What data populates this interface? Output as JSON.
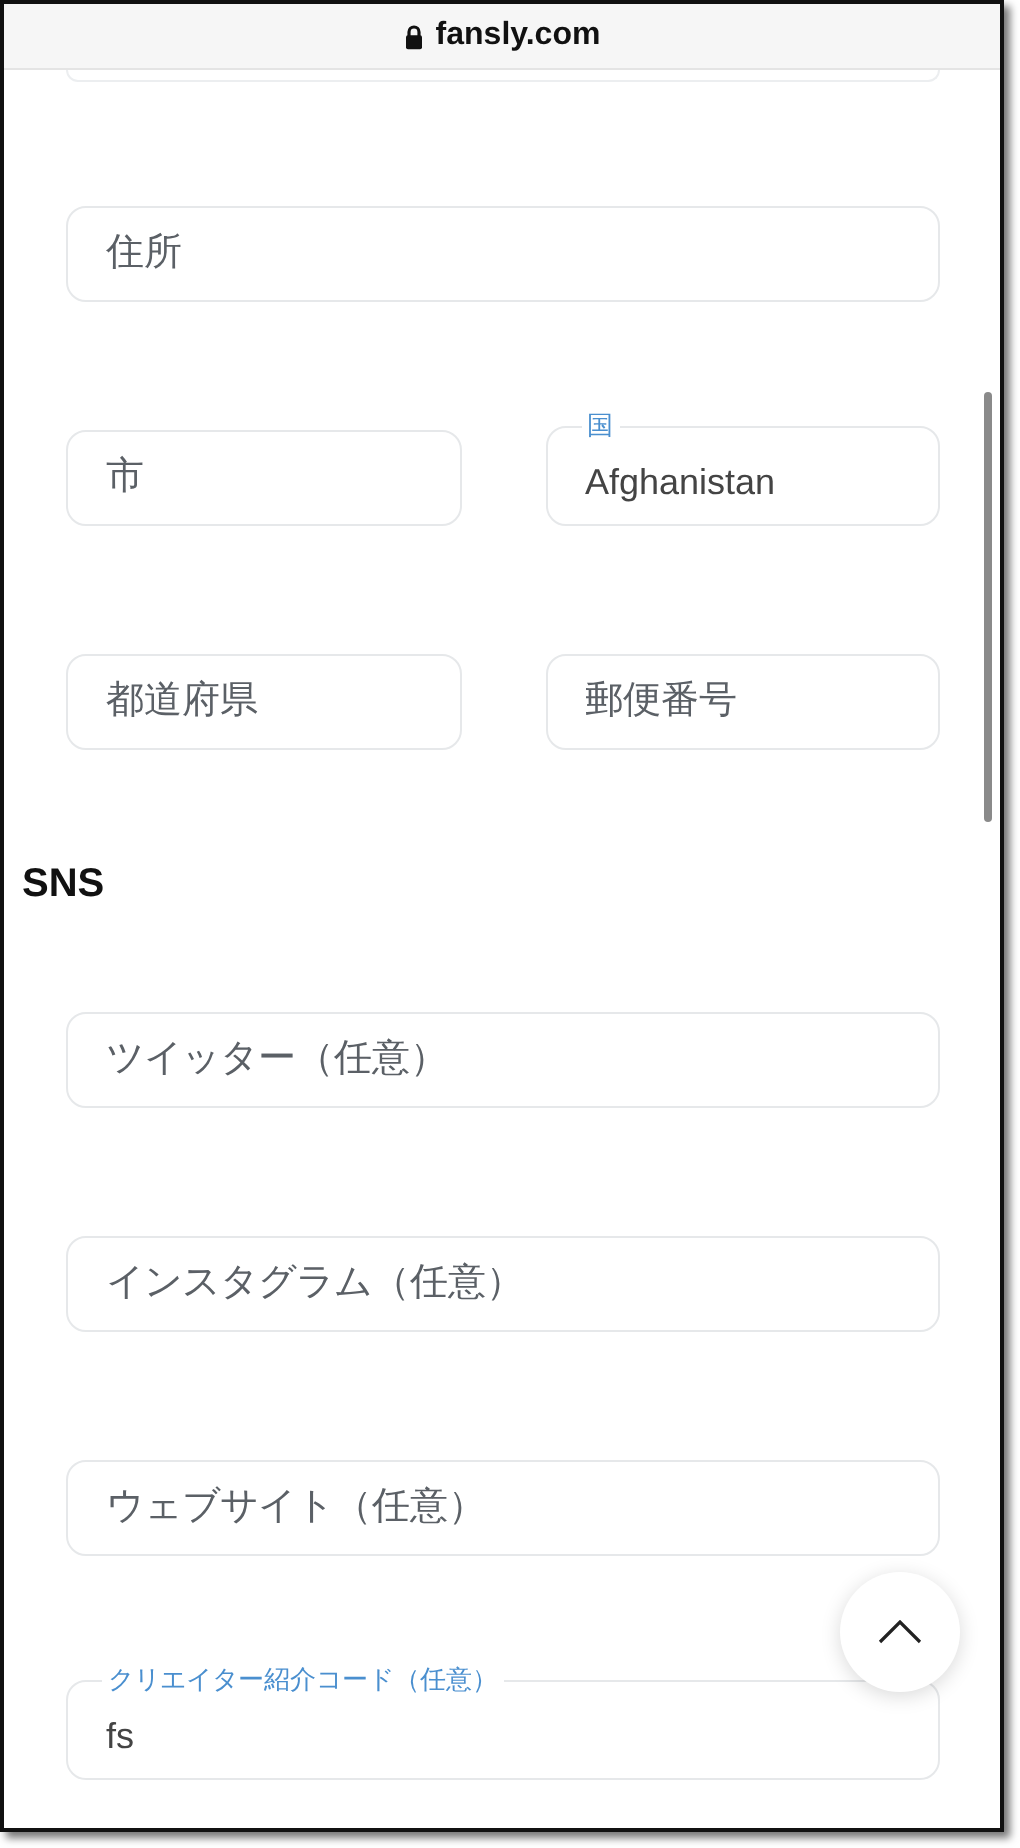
{
  "browser_bar": {
    "url": "fansly.com"
  },
  "address_rows": [
    {
      "fields": [
        {
          "placeholder": "住所"
        }
      ]
    },
    {
      "fields": [
        {
          "placeholder": "市"
        },
        {
          "label": "国",
          "value": "Afghanistan"
        }
      ]
    },
    {
      "fields": [
        {
          "placeholder": "都道府県"
        },
        {
          "placeholder": "郵便番号"
        }
      ]
    }
  ],
  "sns": {
    "heading": "SNS",
    "fields": [
      {
        "placeholder": "ツイッター（任意）"
      },
      {
        "placeholder": "インスタグラム（任意）"
      },
      {
        "placeholder": "ウェブサイト（任意）"
      },
      {
        "label": "クリエイター紹介コード（任意）",
        "value": "fs"
      }
    ]
  }
}
